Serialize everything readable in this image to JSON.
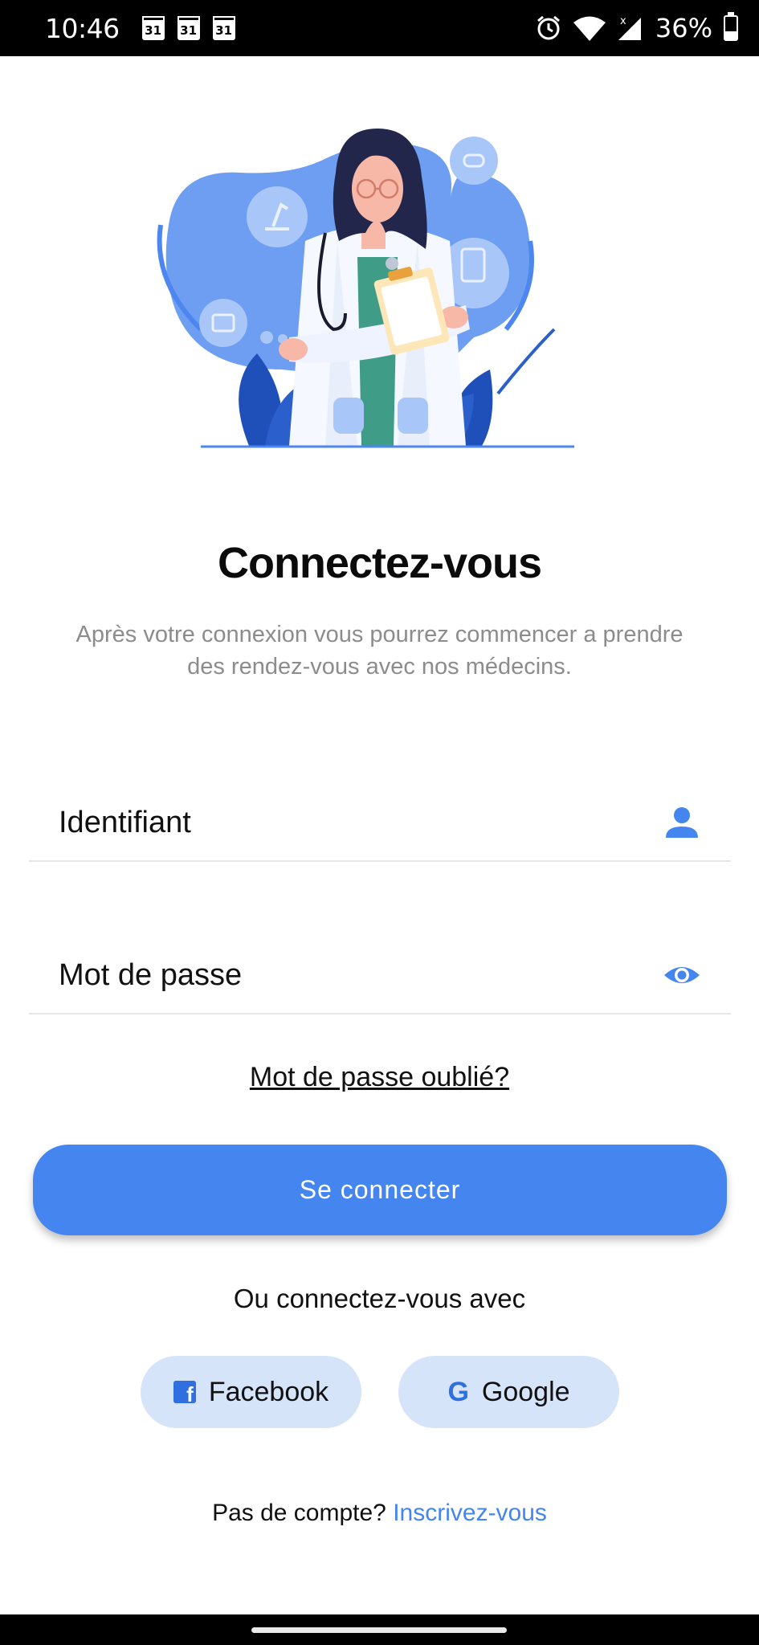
{
  "status_bar": {
    "time": "10:46",
    "calendar_day": "31",
    "battery": "36%"
  },
  "login": {
    "title": "Connectez-vous",
    "subtitle_line1": "Après votre connexion vous pourrez commencer a prendre",
    "subtitle_line2": "des rendez-vous avec nos médecins.",
    "username_label": "Identifiant",
    "password_label": "Mot de passe",
    "forgot_password": "Mot de passe oublié?",
    "submit_label": "Se connecter",
    "alt_login_text": "Ou connectez-vous avec",
    "facebook_label": "Facebook",
    "google_label": "Google",
    "no_account_text": "Pas de compte?",
    "signup_link": "Inscrivez-vous"
  },
  "icons": {
    "username_field": "person-icon",
    "password_field": "eye-icon",
    "facebook": "facebook-icon",
    "google": "google-icon"
  },
  "colors": {
    "primary": "#4485f0",
    "social_button_bg": "#d6e4fa",
    "subtitle": "#8c8c8c"
  }
}
